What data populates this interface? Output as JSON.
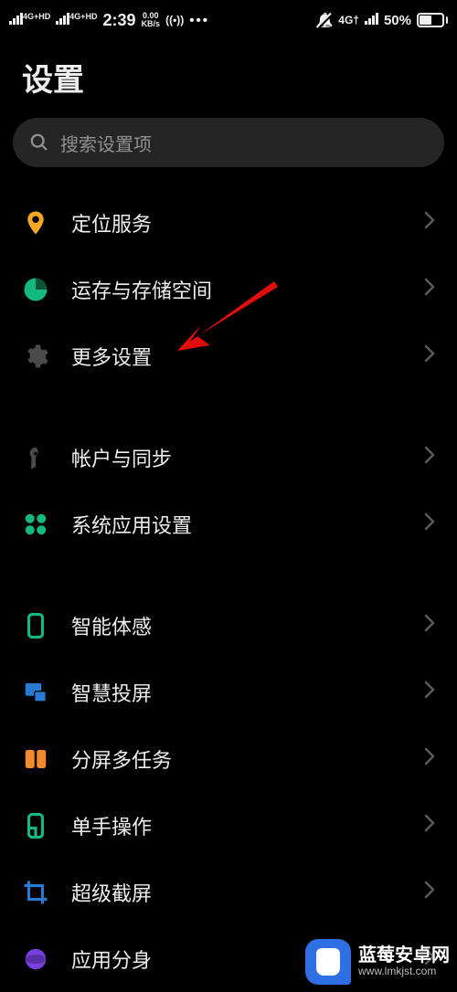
{
  "status_bar": {
    "net1_label": "4G+HD",
    "net2_label": "4G+HD",
    "time": "2:39",
    "speed_top": "0.00",
    "speed_bottom": "KB/s",
    "wifi_label": "((•))",
    "dots": "•••",
    "net_right_label": "4G†",
    "battery_percent": "50%"
  },
  "header": {
    "title": "设置"
  },
  "search": {
    "placeholder": "搜索设置项"
  },
  "groups": [
    {
      "items": [
        {
          "id": "location",
          "label": "定位服务",
          "icon": "location",
          "icon_color": "#f5a623"
        },
        {
          "id": "storage",
          "label": "运存与存储空间",
          "icon": "pie",
          "icon_color": "#14b97f"
        },
        {
          "id": "more-settings",
          "label": "更多设置",
          "icon": "gear",
          "icon_color": "#4a4a4a"
        }
      ]
    },
    {
      "items": [
        {
          "id": "account-sync",
          "label": "帐户与同步",
          "icon": "key",
          "icon_color": "#4a4a4a"
        },
        {
          "id": "system-apps",
          "label": "系统应用设置",
          "icon": "four-dots",
          "icon_color": "#14b97f"
        }
      ]
    },
    {
      "items": [
        {
          "id": "smart-motion",
          "label": "智能体感",
          "icon": "phone-rect",
          "icon_color": "#14b97f"
        },
        {
          "id": "smart-cast",
          "label": "智慧投屏",
          "icon": "cast",
          "icon_color": "#2a7ad4"
        },
        {
          "id": "split-screen",
          "label": "分屏多任务",
          "icon": "split",
          "icon_color": "#f08a2c"
        },
        {
          "id": "one-hand",
          "label": "单手操作",
          "icon": "phone-corner",
          "icon_color": "#14b97f"
        },
        {
          "id": "super-shot",
          "label": "超级截屏",
          "icon": "crop",
          "icon_color": "#2a7ad4"
        },
        {
          "id": "app-clone",
          "label": "应用分身",
          "icon": "sphere",
          "icon_color": "#7a3fe0"
        }
      ]
    }
  ],
  "watermark": {
    "name": "蓝莓安卓网",
    "url": "www.lmkjst.com"
  }
}
